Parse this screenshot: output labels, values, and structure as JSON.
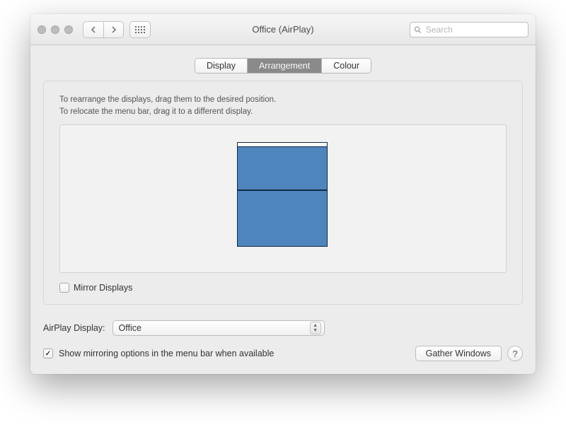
{
  "window": {
    "title": "Office (AirPlay)"
  },
  "search": {
    "placeholder": "Search"
  },
  "tabs": {
    "display": "Display",
    "arrangement": "Arrangement",
    "colour": "Colour"
  },
  "instructions": {
    "line1": "To rearrange the displays, drag them to the desired position.",
    "line2": "To relocate the menu bar, drag it to a different display."
  },
  "mirror": {
    "label": "Mirror Displays",
    "checked": false
  },
  "airplay": {
    "label": "AirPlay Display:",
    "selected": "Office"
  },
  "showMirroring": {
    "label": "Show mirroring options in the menu bar when available",
    "checked": true
  },
  "buttons": {
    "gather": "Gather Windows",
    "help": "?"
  }
}
